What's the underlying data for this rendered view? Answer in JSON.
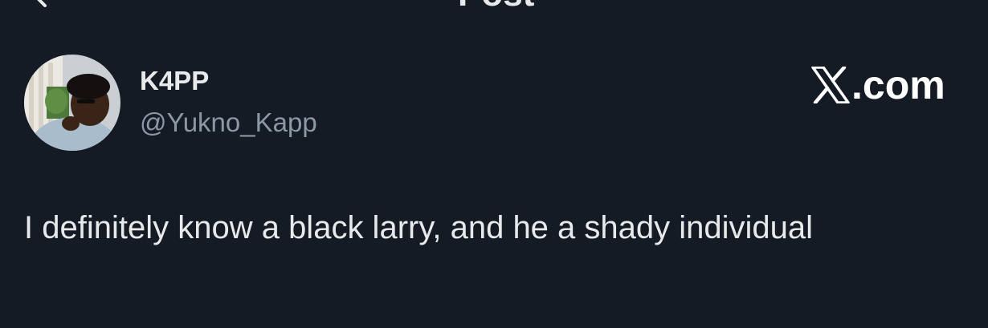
{
  "header": {
    "title": "Post",
    "back_icon": "arrow-left-icon"
  },
  "author": {
    "display_name": "K4PP",
    "handle": "@Yukno_Kapp",
    "avatar_icon": "profile-photo"
  },
  "brand": {
    "logo_icon": "x-logo-icon",
    "text": ".com",
    "color": "#ffffff"
  },
  "post": {
    "text": "I definitely know a black larry, and he a shady individual"
  },
  "colors": {
    "background": "#151b25",
    "primary_text": "#e7e9ea",
    "secondary_text": "#8b98a5"
  }
}
